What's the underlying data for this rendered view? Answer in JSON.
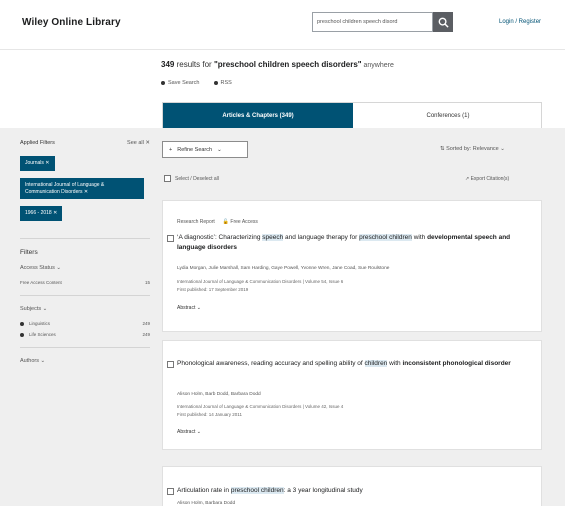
{
  "header": {
    "brand": "Wiley Online Library",
    "search_value": "preschool children speech disord",
    "login": "Login / Register"
  },
  "results": {
    "count": "349",
    "text_mid": " results for ",
    "query": "\"preschool children speech disorders\"",
    "scope": " anywhere",
    "links": [
      "Save Search",
      "RSS"
    ]
  },
  "tabs": [
    "Articles & Chapters (349)",
    "Conferences (1)"
  ],
  "toolbar": {
    "refine": "Refine Search",
    "sort": "Sorted by: Relevance",
    "select_all": "Select / Deselect all",
    "export": "Export Citation(s)"
  },
  "sidebar": {
    "applied_title": "Applied Filters",
    "see_all": "See all",
    "pills": [
      "Journals",
      "International Journal of Language & Communication Disorders",
      "1966 - 2018"
    ],
    "filters_title": "Filters",
    "access_label": "Access Status",
    "access_item": "Free Access Content",
    "access_count": "15",
    "subjects_label": "Subjects",
    "subjects": [
      {
        "label": "Linguistics",
        "count": "249"
      },
      {
        "label": "Life Sciences",
        "count": "249"
      }
    ],
    "authors_label": "Authors"
  },
  "cards": [
    {
      "type": "Research Report",
      "access": "Free Access",
      "title": [
        {
          "t": "‘A diagnostic’: Characterizing ",
          "s": ""
        },
        {
          "t": "speech",
          "s": "hl"
        },
        {
          "t": " and language therapy for ",
          "s": ""
        },
        {
          "t": "preschool children",
          "s": "hl"
        },
        {
          "t": " with ",
          "s": ""
        },
        {
          "t": "developmental speech and language disorders",
          "s": "b"
        }
      ],
      "authors": "Lydia Morgan, Julie Marshall, Sam Harding, Gaye Powell, Yvonne Wren, Jane Coad, Sue Roulstone",
      "journal": "International Journal of Language & Communication Disorders | Volume 54, Issue 6",
      "published": "First published: 17 September 2019",
      "abstract": "Abstract"
    },
    {
      "title": [
        {
          "t": "Phonological awareness, reading accuracy and spelling ability of ",
          "s": ""
        },
        {
          "t": "children",
          "s": "hl"
        },
        {
          "t": " with ",
          "s": ""
        },
        {
          "t": "inconsistent phonological disorder",
          "s": "b"
        }
      ],
      "authors": "Alison Holm, Barb Dodd, Barbara Dodd",
      "journal": "International Journal of Language & Communication Disorders | Volume 42, Issue 4",
      "published": "First published: 14 January 2011",
      "abstract": "Abstract"
    },
    {
      "title": [
        {
          "t": "Articulation rate in ",
          "s": ""
        },
        {
          "t": "preschool children",
          "s": "hl"
        },
        {
          "t": ": a 3 year longitudinal study",
          "s": ""
        }
      ],
      "authors": "Alison Holm, Barbara Dodd",
      "journal": "",
      "published": "",
      "abstract": ""
    }
  ]
}
